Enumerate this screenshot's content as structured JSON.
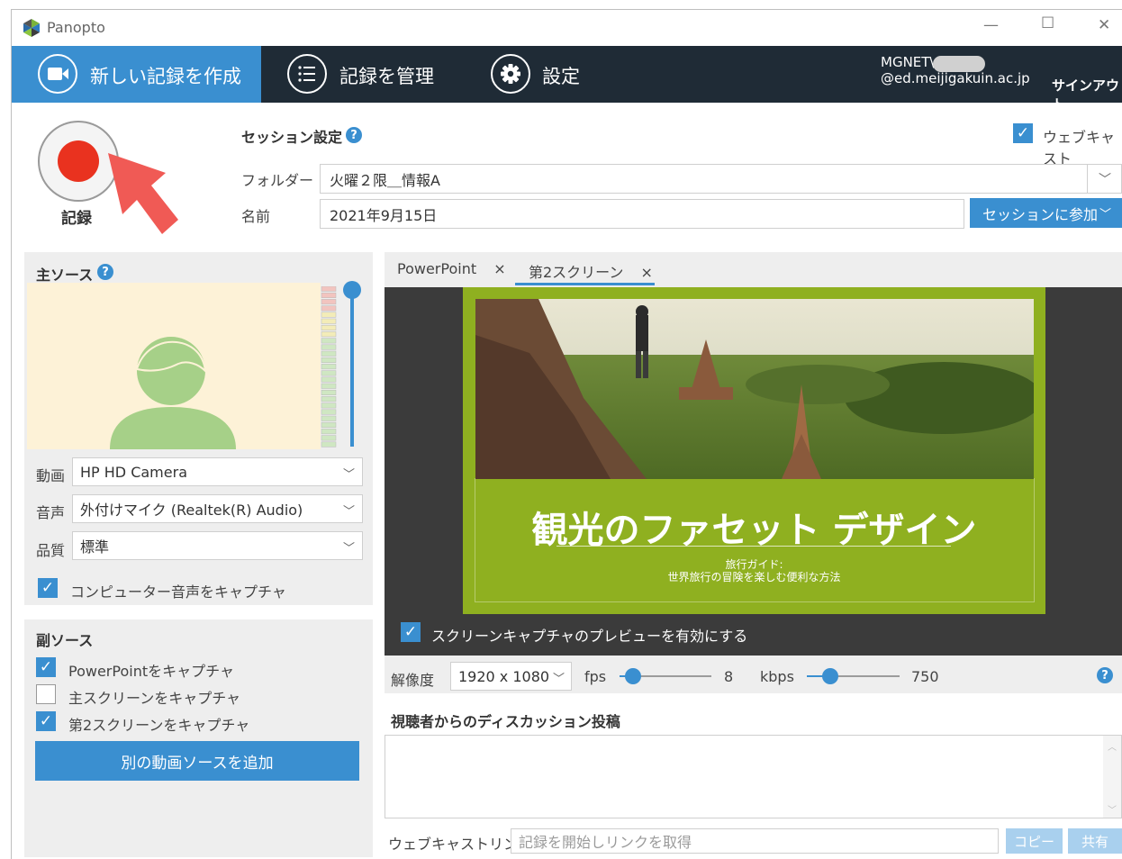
{
  "app": {
    "title": "Panopto"
  },
  "nav": {
    "create": "新しい記録を作成",
    "manage": "記録を管理",
    "settings": "設定",
    "user_email_prefix": "MGNET\\",
    "user_email_suffix": "@ed.meijigakuin.ac.jp",
    "signout": "サインアウト"
  },
  "record": {
    "label": "記録"
  },
  "session": {
    "heading": "セッション設定",
    "folder_label": "フォルダー",
    "folder_value": "火曜２限＿情報A",
    "name_label": "名前",
    "name_value": "2021年9月15日",
    "join_button": "セッションに参加",
    "webcast_label": "ウェブキャスト",
    "webcast_checked": true
  },
  "primary": {
    "heading": "主ソース",
    "video_label": "動画",
    "video_value": "HP HD Camera",
    "audio_label": "音声",
    "audio_value": "外付けマイク (Realtek(R) Audio)",
    "quality_label": "品質",
    "quality_value": "標準",
    "capture_audio_label": "コンピューター音声をキャプチャ",
    "capture_audio_checked": true
  },
  "secondary": {
    "heading": "副ソース",
    "items": [
      {
        "label": "PowerPointをキャプチャ",
        "checked": true
      },
      {
        "label": "主スクリーンをキャプチャ",
        "checked": false
      },
      {
        "label": "第2スクリーンをキャプチャ",
        "checked": true
      }
    ],
    "add_button": "別の動画ソースを追加"
  },
  "tabs": [
    {
      "label": "PowerPoint",
      "close": "×",
      "active": false
    },
    {
      "label": "第2スクリーン",
      "close": "×",
      "active": true
    }
  ],
  "slide": {
    "title": "観光のファセット デザイン",
    "sub1": "旅行ガイド:",
    "sub2": "世界旅行の冒険を楽しむ便利な方法"
  },
  "preview": {
    "enable_label": "スクリーンキャプチャのプレビューを有効にする",
    "enable_checked": true
  },
  "encoding": {
    "resolution_label": "解像度",
    "resolution_value": "1920 x 1080",
    "fps_label": "fps",
    "fps_value": "8",
    "fps_level": 0.15,
    "kbps_label": "kbps",
    "kbps_value": "750",
    "kbps_level": 0.25
  },
  "discussion": {
    "heading": "視聴者からのディスカッション投稿"
  },
  "webcast_link": {
    "label": "ウェブキャストリンク",
    "placeholder": "記録を開始しリンクを取得",
    "copy": "コピー",
    "share": "共有"
  },
  "colors": {
    "accent": "#3a8fd0",
    "nav_dark": "#1f2b36",
    "record_red": "#e9321f",
    "arrow_red": "#f05a55",
    "slide_green": "#8fb020"
  }
}
